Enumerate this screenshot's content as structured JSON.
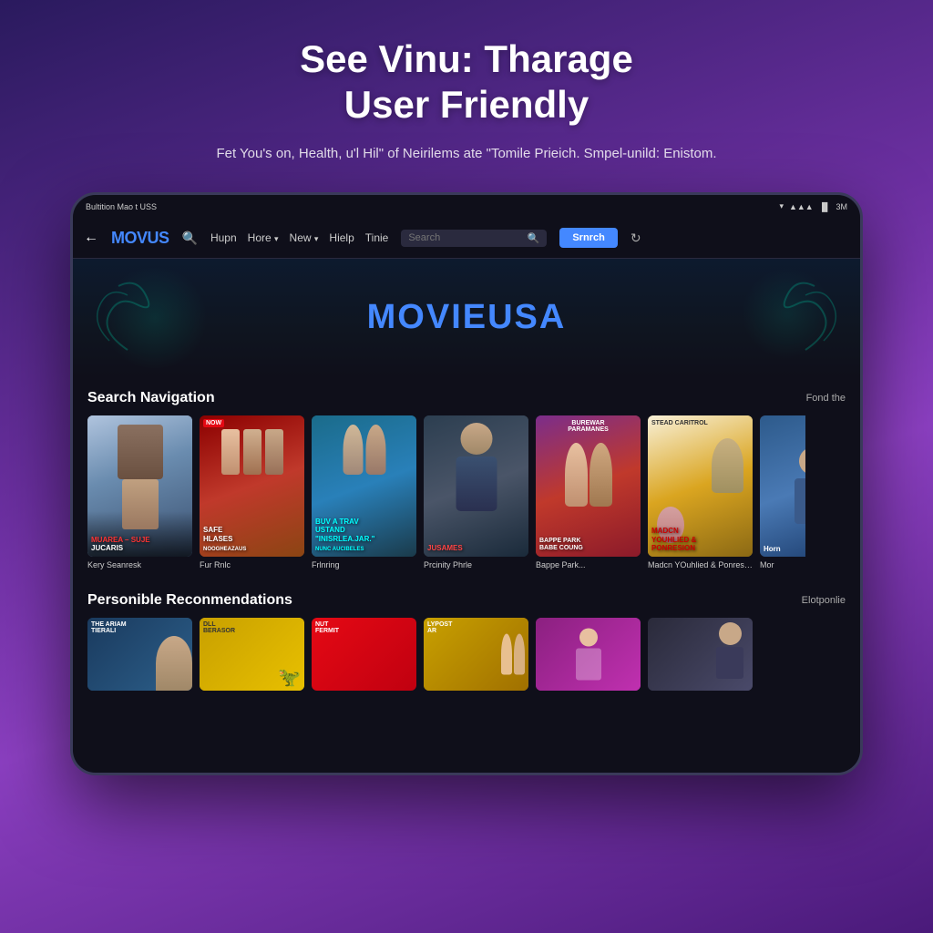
{
  "hero": {
    "title": "See Vinu: Tharage\nUser Friendly",
    "subtitle": "Fet You's on, Health, u'l Hil\" of Neirilems ate \"Tomile Prieich. Smpel-unild: Enistom."
  },
  "status_bar": {
    "left": "Bultition Mao t USS",
    "right": "3M"
  },
  "navbar": {
    "logo_part1": "MOV",
    "logo_part2": "US",
    "nav_home": "Hupn",
    "nav_more": "Hore",
    "nav_new": "New",
    "nav_help": "Hielp",
    "nav_title": "Tinie",
    "search_placeholder": "Search",
    "btn_switch": "Srnrch"
  },
  "banner": {
    "logo_part1": "MOVIE",
    "logo_part2": "USA"
  },
  "search_nav_section": {
    "title": "Search Navigation",
    "link": "Fond the"
  },
  "movies": [
    {
      "id": 1,
      "title": "Kery Seanresk",
      "subtitle": "MUAREA – SUJE JUCARIS",
      "badge": "",
      "poster_class": "poster-1"
    },
    {
      "id": 2,
      "title": "Fur Rnlc",
      "subtitle": "NOOGHEAZAUS",
      "badge": "NOW",
      "poster_class": "poster-2"
    },
    {
      "id": 3,
      "title": "Frlnring",
      "subtitle": "NUNC AUCIBELES",
      "badge": "",
      "poster_class": "poster-3"
    },
    {
      "id": 4,
      "title": "Prcinity Phrle",
      "subtitle": "JUSAMES",
      "badge": "",
      "poster_class": "poster-4"
    },
    {
      "id": 5,
      "title": "Bappe Park...",
      "subtitle": "PARAMANES",
      "badge": "",
      "poster_class": "poster-5"
    },
    {
      "id": 6,
      "title": "Madcn YOuhlied & Ponresion",
      "subtitle": "STEAD CARITROL",
      "badge": "",
      "poster_class": "poster-6"
    },
    {
      "id": 7,
      "title": "Mor",
      "subtitle": "Horn",
      "badge": "",
      "poster_class": "poster-7"
    }
  ],
  "recommendations_section": {
    "title": "Personible Reconmendations",
    "link": "Elotponlie"
  },
  "recommendations": [
    {
      "id": 1,
      "title": "THE ARIAM TIERALI",
      "bg_class": "rec-bg-1"
    },
    {
      "id": 2,
      "title": "DLL BERASOR",
      "bg_class": "rec-bg-2"
    },
    {
      "id": 3,
      "title": "NUT FERMIT",
      "bg_class": "rec-bg-3"
    },
    {
      "id": 4,
      "title": "LYPOST AR",
      "bg_class": "rec-bg-4"
    },
    {
      "id": 5,
      "title": "",
      "bg_class": "rec-bg-5"
    },
    {
      "id": 6,
      "title": "",
      "bg_class": "rec-bg-6"
    }
  ]
}
